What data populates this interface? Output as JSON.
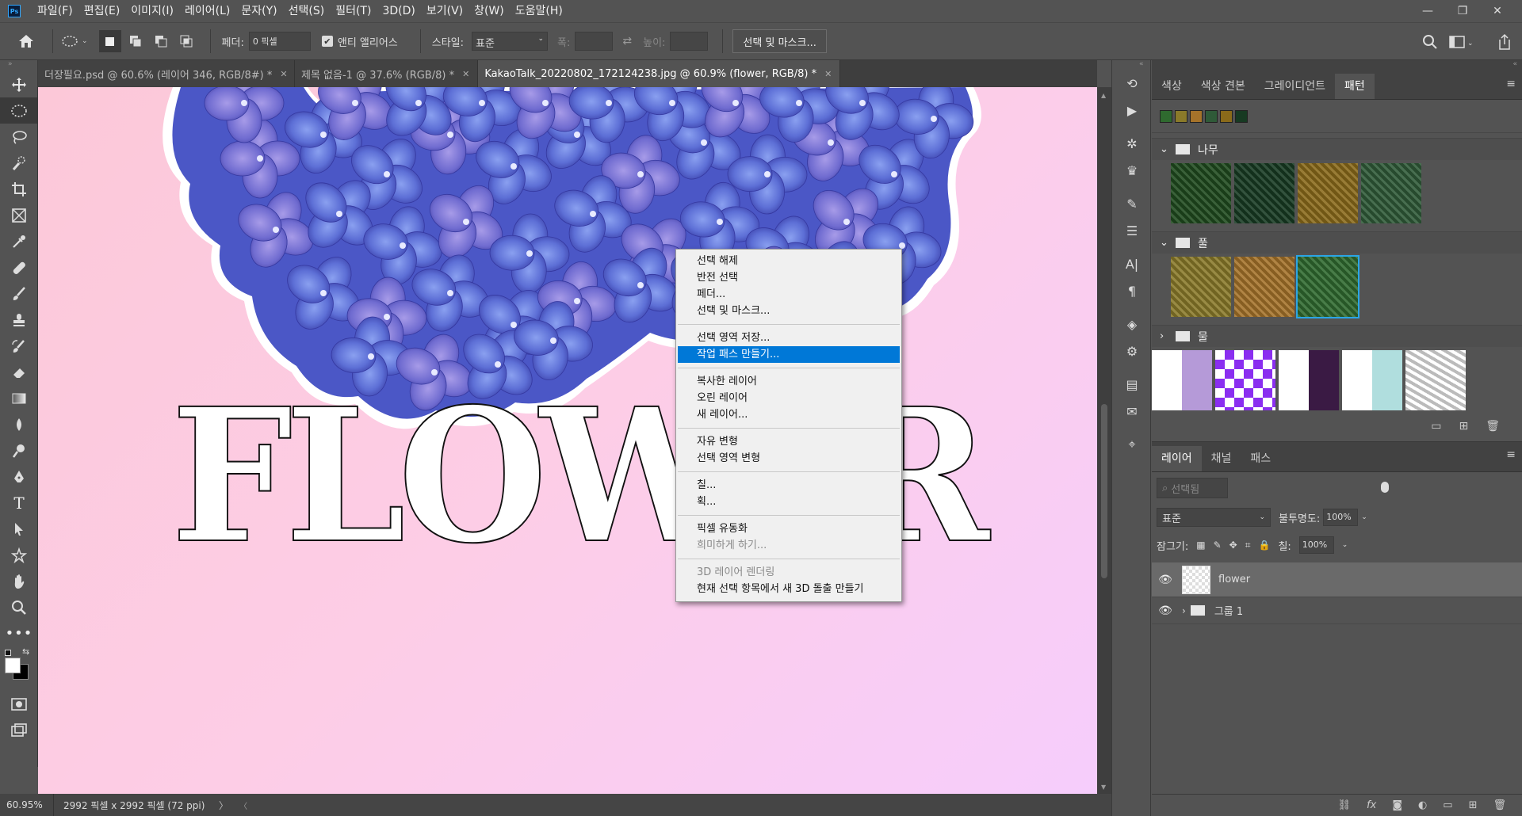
{
  "menubar": {
    "items": [
      "파일(F)",
      "편집(E)",
      "이미지(I)",
      "레이어(L)",
      "문자(Y)",
      "선택(S)",
      "필터(T)",
      "3D(D)",
      "보기(V)",
      "창(W)",
      "도움말(H)"
    ]
  },
  "options": {
    "feather_label": "페더:",
    "feather_value": "0 픽셀",
    "antialias_label": "앤티 앨리어스",
    "antialias_checked": true,
    "style_label": "스타일:",
    "style_value": "표준",
    "width_label": "폭:",
    "height_label": "높이:",
    "select_mask_button": "선택 및 마스크..."
  },
  "tabs": [
    {
      "label": "더장필요.psd @ 60.6% (레이어 346, RGB/8#) *",
      "active": false
    },
    {
      "label": "제목 없음-1 @ 37.6% (RGB/8) *",
      "active": false
    },
    {
      "label": "KakaoTalk_20220802_172124238.jpg @ 60.9% (flower, RGB/8) *",
      "active": true
    }
  ],
  "canvas": {
    "text": "FLOWER"
  },
  "context_menu": {
    "groups": [
      [
        {
          "label": "선택 해제"
        },
        {
          "label": "반전 선택"
        },
        {
          "label": "페더..."
        },
        {
          "label": "선택 및 마스크..."
        }
      ],
      [
        {
          "label": "선택 영역 저장..."
        },
        {
          "label": "작업 패스 만들기...",
          "highlighted": true
        }
      ],
      [
        {
          "label": "복사한 레이어"
        },
        {
          "label": "오린 레이어"
        },
        {
          "label": "새 레이어..."
        }
      ],
      [
        {
          "label": "자유 변형"
        },
        {
          "label": "선택 영역 변형"
        }
      ],
      [
        {
          "label": "칠..."
        },
        {
          "label": "획..."
        }
      ],
      [
        {
          "label": "픽셀 유동화"
        },
        {
          "label": "희미하게 하기...",
          "disabled": true
        }
      ],
      [
        {
          "label": "3D 레이어 렌더링",
          "disabled": true
        },
        {
          "label": "현재 선택 항목에서 새 3D 돌출 만들기"
        }
      ]
    ]
  },
  "status": {
    "zoom": "60.95%",
    "doc_size": "2992 픽셀 x 2992 픽셀 (72 ppi)"
  },
  "pattern_panel": {
    "tabs": [
      "색상",
      "색상 견본",
      "그레이디언트",
      "패턴"
    ],
    "active_tab": "패턴",
    "groups": [
      {
        "name": "나무",
        "expanded": true,
        "colors": [
          "#1f4a1e",
          "#173a22",
          "#8a6a1a",
          "#2f5a38"
        ]
      },
      {
        "name": "풀",
        "expanded": true,
        "colors": [
          "#8a7a2a",
          "#a5732a",
          "#2f6a2f"
        ],
        "selected_index": 2
      },
      {
        "name": "물",
        "expanded": false,
        "colors": []
      }
    ],
    "colors": {
      "selected_border": "#2aa6e6"
    }
  },
  "layers_panel": {
    "tabs": [
      "레이어",
      "채널",
      "패스"
    ],
    "active_tab": "레이어",
    "kind_placeholder": "선택됨",
    "blend_mode": "표준",
    "opacity_label": "불투명도:",
    "opacity_value": "100%",
    "lock_label": "잠그기:",
    "fill_label": "칠:",
    "fill_value": "100%",
    "layers": [
      {
        "name": "flower",
        "selected": true
      },
      {
        "name": "그룹 1",
        "selected": false
      }
    ]
  }
}
